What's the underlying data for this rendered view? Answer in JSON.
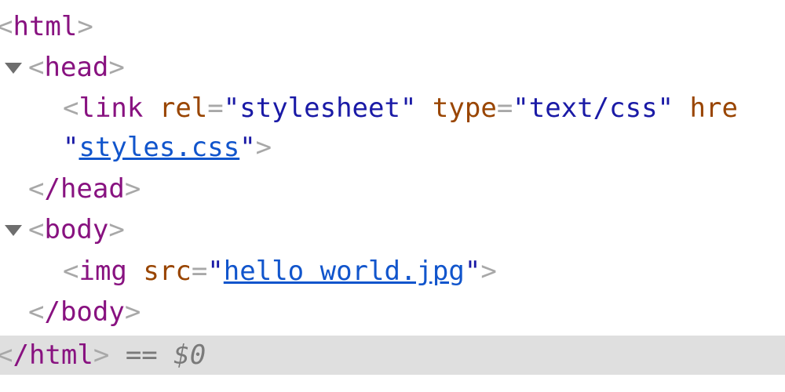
{
  "dom_tree": {
    "html_open": "html",
    "head_tag": "head",
    "link_tag": "link",
    "link_rel_attr": "rel",
    "link_rel_value": "stylesheet",
    "link_type_attr": "type",
    "link_type_value": "text/css",
    "link_href_attr": "hre",
    "link_href_value": "styles.css",
    "head_close": "/head",
    "body_tag": "body",
    "img_tag": "img",
    "img_src_attr": "src",
    "img_src_value": "hello world.jpg",
    "body_close": "/body",
    "html_close": "/html",
    "selected_ref_eq": "==",
    "selected_ref_var": "$0"
  },
  "colors": {
    "tag": "#881280",
    "attribute": "#994500",
    "value": "#1a1aa6",
    "link": "#1155cc",
    "selected_background": "#dfdfdf"
  }
}
